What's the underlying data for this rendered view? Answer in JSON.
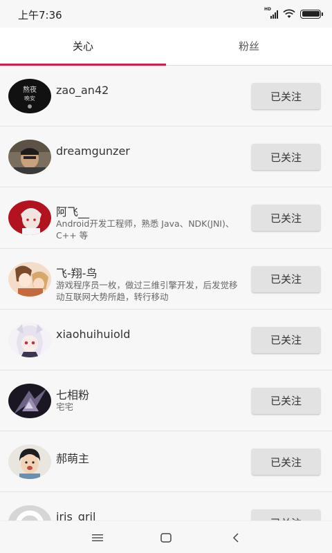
{
  "status_bar": {
    "time": "上午7:36",
    "hd": "HD"
  },
  "tabs": [
    {
      "label": "关心",
      "active": true
    },
    {
      "label": "粉丝",
      "active": false
    }
  ],
  "accent_color": "#d81b4c",
  "users": [
    {
      "name": "zao_an42",
      "desc": "",
      "button": "已关注"
    },
    {
      "name": "dreamgunzer",
      "desc": "",
      "button": "已关注"
    },
    {
      "name": "阿飞__",
      "desc": "Android开发工程师，熟悉 Java、NDK(JNI)、C++ 等",
      "button": "已关注"
    },
    {
      "name": "飞-翔-鸟",
      "desc": "游戏程序员一枚，做过三维引擎开发，后发觉移动互联网大势所趋，转行移动",
      "button": "已关注"
    },
    {
      "name": "xiaohuihuiold",
      "desc": "",
      "button": "已关注"
    },
    {
      "name": "七相粉",
      "desc": "宅宅",
      "button": "已关注"
    },
    {
      "name": "郝萌主",
      "desc": "",
      "button": "已关注"
    },
    {
      "name": "iris_gril",
      "desc": "",
      "button": "已关注"
    }
  ],
  "nav_bar": {
    "icons": [
      "menu-icon",
      "home-icon",
      "back-icon"
    ]
  }
}
